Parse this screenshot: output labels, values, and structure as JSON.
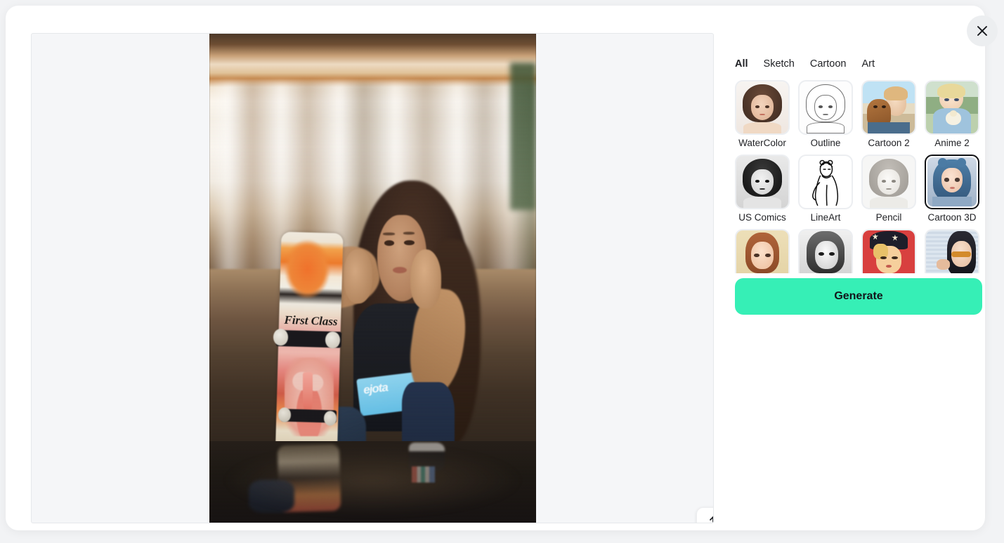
{
  "window": {
    "close_label": "Close",
    "close_icon": "close-icon"
  },
  "canvas": {
    "upload_icon": "upload-icon",
    "upload_label": "Upload image",
    "photo_alt": "Young woman sitting on parking-garage floor leaning on a First Class skateboard, reflected in a puddle"
  },
  "panel": {
    "tabs": [
      {
        "label": "All",
        "active": true
      },
      {
        "label": "Sketch",
        "active": false
      },
      {
        "label": "Cartoon",
        "active": false
      },
      {
        "label": "Art",
        "active": false
      }
    ],
    "styles": [
      {
        "label": "WaterColor",
        "selected": false
      },
      {
        "label": "Outline",
        "selected": false
      },
      {
        "label": "Cartoon 2",
        "selected": false
      },
      {
        "label": "Anime 2",
        "selected": false
      },
      {
        "label": "US Comics",
        "selected": false
      },
      {
        "label": "LineArt",
        "selected": false
      },
      {
        "label": "Pencil",
        "selected": false
      },
      {
        "label": "Cartoon 3D",
        "selected": true
      },
      {
        "label": "",
        "selected": false
      },
      {
        "label": "",
        "selected": false
      },
      {
        "label": "",
        "selected": false
      },
      {
        "label": "",
        "selected": false
      }
    ],
    "generate_label": "Generate"
  },
  "colors": {
    "accent": "#36efb6",
    "page_bg": "#f2f3f5",
    "modal_bg": "#ffffff",
    "canvas_bg": "#f5f6f8",
    "selected_border": "#111215",
    "text": "#1f2024"
  }
}
